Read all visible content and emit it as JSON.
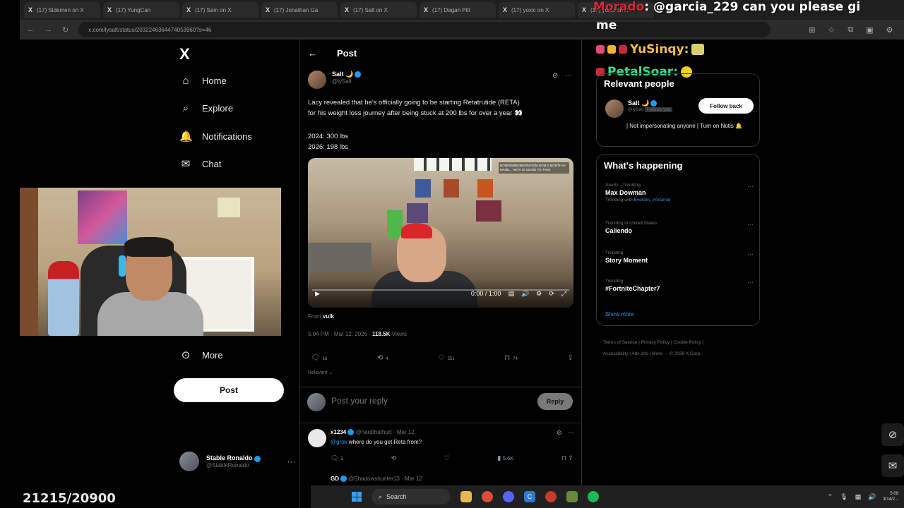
{
  "browser": {
    "tabs": [
      {
        "label": "(17) Sidemen on X"
      },
      {
        "label": "(17) YungCan"
      },
      {
        "label": "(17) Sam on X"
      },
      {
        "label": "(17) Jonathan Ga"
      },
      {
        "label": "(17) Salt on X"
      },
      {
        "label": "(17) Dagan Pitt"
      },
      {
        "label": "(17) yoxic on X"
      },
      {
        "label": "(17) yoxic on X"
      }
    ],
    "url": "x.com/lysalt/status/2032246364474053960?s=46"
  },
  "stream_chat": {
    "top_line_name": "Morado",
    "top_line_text": ": @garcia_229 can you please gi",
    "top_line_cont": "me",
    "users": [
      {
        "name": "YuSinqy:",
        "color": "#f0c04a"
      },
      {
        "name": "PetalSoar:",
        "color": "#41d98a"
      }
    ]
  },
  "sidebar": {
    "logo": "X",
    "items": [
      {
        "label": "Home",
        "icon": "home-icon",
        "glyph": "⌂"
      },
      {
        "label": "Explore",
        "icon": "search-icon",
        "glyph": "⌕"
      },
      {
        "label": "Notifications",
        "icon": "bell-icon",
        "glyph": "🔔"
      },
      {
        "label": "Chat",
        "icon": "mail-icon",
        "glyph": "✉"
      },
      {
        "label": "More",
        "icon": "more-icon",
        "glyph": "⊙"
      }
    ],
    "post_label": "Post",
    "account": {
      "name": "Stable Ronaldo",
      "handle": "@StableRonaldo"
    }
  },
  "post": {
    "header": "Post",
    "author": {
      "name": "Salt",
      "handle": "@lySalt"
    },
    "text_lines": [
      "Lacy revealed that he's officially going to be starting Retatrutide (RETA)",
      "for his weight loss journey after being stuck at 200 lbs for over a year 👀"
    ],
    "stat_lines": [
      "2024: 300 lbs",
      "2026: 198 lbs"
    ],
    "video": {
      "time": "0:00 / 1:00",
      "overlay": "NOMNOMNOMNOM NOM NOM 1 MONTH IN MAND... RETA IS GOING TO TAKE"
    },
    "from_label": "From",
    "from_user": "vulk",
    "timestamp": "5:04 PM · Mar 12, 2026 ·",
    "views": "118.5K",
    "views_label": "Views",
    "actions": {
      "replies": "16",
      "reposts": "4",
      "likes": "551",
      "bookmarks": "74"
    },
    "relevant_label": "Relevant ⌄"
  },
  "reply": {
    "placeholder": "Post your reply",
    "button": "Reply"
  },
  "comments": [
    {
      "name": "x1234",
      "handle": "@hardthathurt · Mar 12",
      "mention": "@grok",
      "text": "where do you get Reta from?",
      "replies": "1",
      "views": "5.6K"
    },
    {
      "name": "GD",
      "handle": "@Shadowshunter13 · Mar 12"
    }
  ],
  "right": {
    "relevant_title": "Relevant people",
    "person": {
      "name": "Salt",
      "handle": "@lySalt",
      "follows": "Follows you",
      "bio": "| Not impersonating anyone | Turn on Notis 🔔",
      "button": "Follow back"
    },
    "happening_title": "What's happening",
    "trends": [
      {
        "category": "Sports · Trending",
        "title": "Max Dowman",
        "sub_prefix": "Trending with",
        "sub_links": "Everton, #Arsenal"
      },
      {
        "category": "Trending in United States",
        "title": "Caliendo"
      },
      {
        "category": "Trending",
        "title": "Story Moment"
      },
      {
        "category": "Trending",
        "title": "#FortniteChapter7"
      }
    ],
    "show_more": "Show more",
    "footer_line1": "Terms of Service  |  Privacy Policy  |  Cookie Policy  |",
    "footer_line2": "Accessibility  |  Ads info  |  More ···  © 2026 X Corp."
  },
  "overlay": {
    "counter": "21215/20900"
  },
  "taskbar": {
    "search_label": "Search",
    "clock_time": "5:09",
    "clock_date": "3/14/2..."
  }
}
